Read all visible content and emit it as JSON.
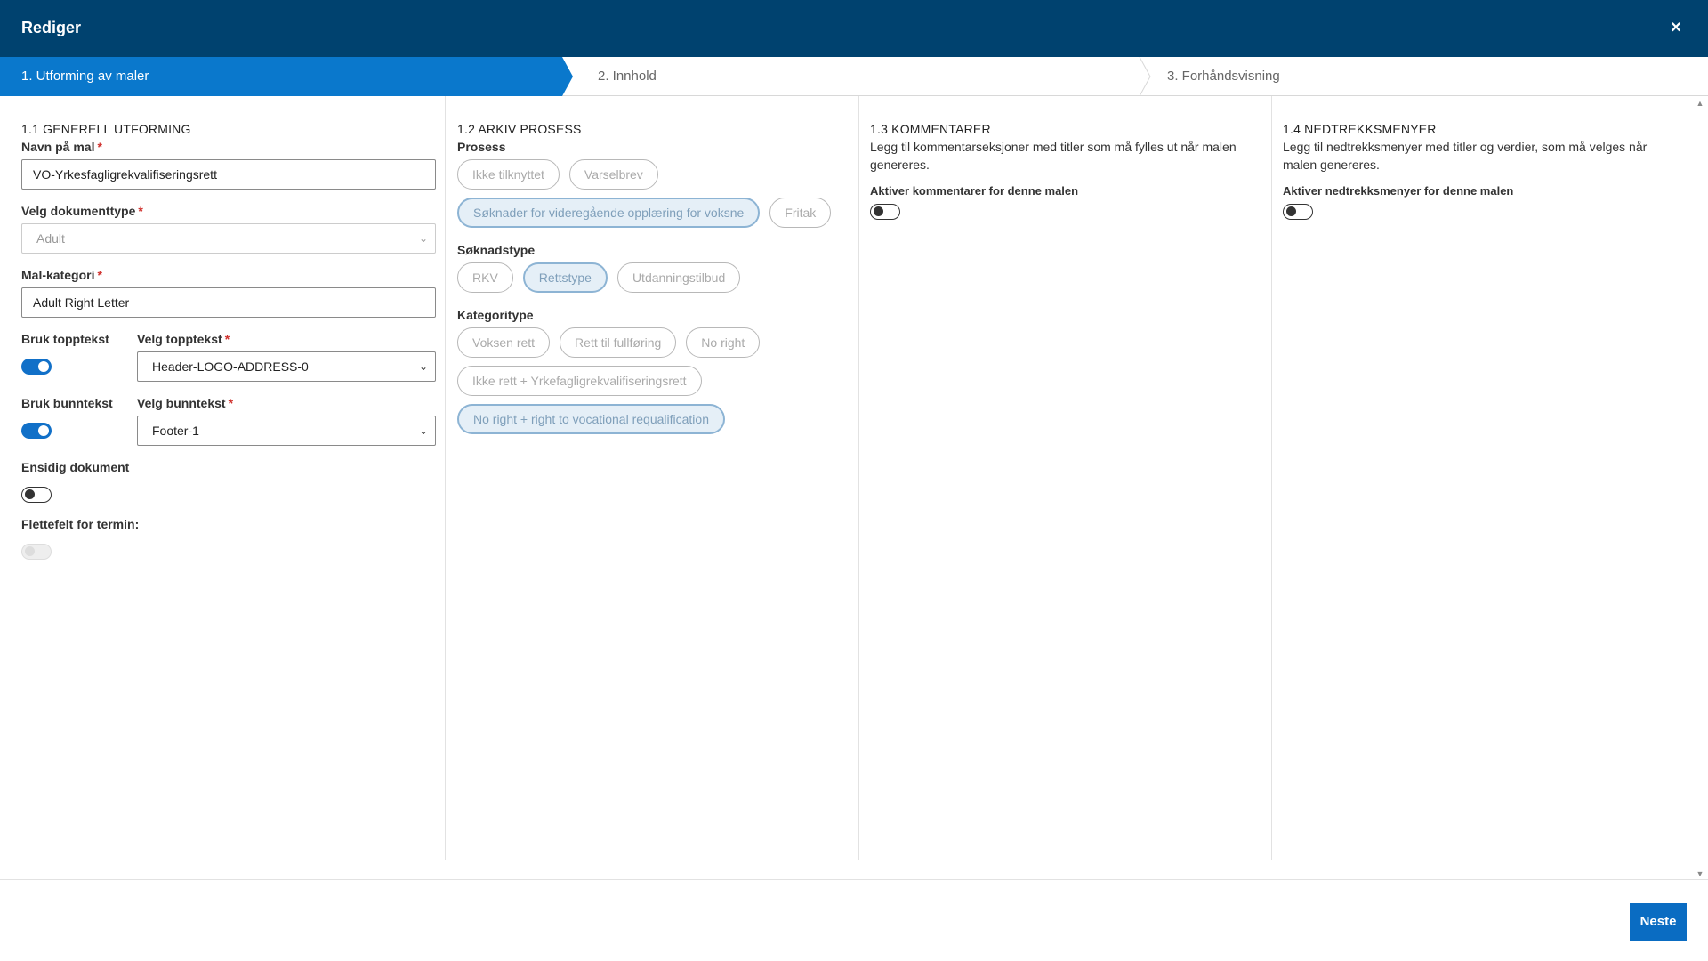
{
  "dialog": {
    "title": "Rediger",
    "close_icon": "×"
  },
  "steps": [
    {
      "label": "1. Utforming av maler",
      "active": true
    },
    {
      "label": "2. Innhold",
      "active": false
    },
    {
      "label": "3. Forhåndsvisning",
      "active": false
    }
  ],
  "general": {
    "title": "1.1 GENERELL UTFORMING",
    "name_label": "Navn på mal",
    "name_value": "VO-Yrkesfagligrekvalifiseringsrett",
    "doctype_label": "Velg dokumenttype",
    "doctype_value": "Adult",
    "category_label": "Mal-kategori",
    "category_value": "Adult Right Letter",
    "use_header_label": "Bruk topptekst",
    "use_header_on": true,
    "header_select_label": "Velg topptekst",
    "header_select_value": "Header-LOGO-ADDRESS-0",
    "use_footer_label": "Bruk bunntekst",
    "use_footer_on": true,
    "footer_select_label": "Velg bunntekst",
    "footer_select_value": "Footer-1",
    "single_sided_label": "Ensidig dokument",
    "single_sided_on": false,
    "merge_field_label": "Flettefelt for termin:",
    "merge_field_on": false,
    "required_mark": "*"
  },
  "archive": {
    "title": "1.2 ARKIV PROSESS",
    "process_label": "Prosess",
    "process_chips": [
      {
        "label": "Ikke tilknyttet",
        "selected": false
      },
      {
        "label": "Varselbrev",
        "selected": false
      },
      {
        "label": "Søknader for videregående opplæring for voksne",
        "selected": true
      },
      {
        "label": "Fritak",
        "selected": false
      }
    ],
    "application_type_label": "Søknadstype",
    "application_type_chips": [
      {
        "label": "RKV",
        "selected": false
      },
      {
        "label": "Rettstype",
        "selected": true
      },
      {
        "label": "Utdanningstilbud",
        "selected": false
      }
    ],
    "category_type_label": "Kategoritype",
    "category_type_chips": [
      {
        "label": "Voksen rett",
        "selected": false
      },
      {
        "label": "Rett til fullføring",
        "selected": false
      },
      {
        "label": "No right",
        "selected": false
      },
      {
        "label": "Ikke rett + Yrkefagligrekvalifiseringsrett",
        "selected": false
      },
      {
        "label": "No right + right to vocational requalification",
        "selected": true
      }
    ]
  },
  "comments": {
    "title": "1.3 KOMMENTARER",
    "description": "Legg til kommentarseksjoner med titler som må fylles ut når malen genereres.",
    "toggle_label": "Aktiver kommentarer for denne malen",
    "toggle_on": false
  },
  "dropdowns": {
    "title": "1.4 NEDTREKKSMENYER",
    "description": "Legg til nedtrekksmenyer med titler og verdier, som må velges når malen genereres.",
    "toggle_label": "Aktiver nedtrekksmenyer for denne malen",
    "toggle_on": false
  },
  "footer": {
    "next_label": "Neste"
  },
  "colors": {
    "header_bg": "#00426f",
    "active_step": "#0a78cc",
    "primary_button": "#0a6cc2",
    "toggle_on": "#1170c8",
    "required": "#d0312d"
  }
}
